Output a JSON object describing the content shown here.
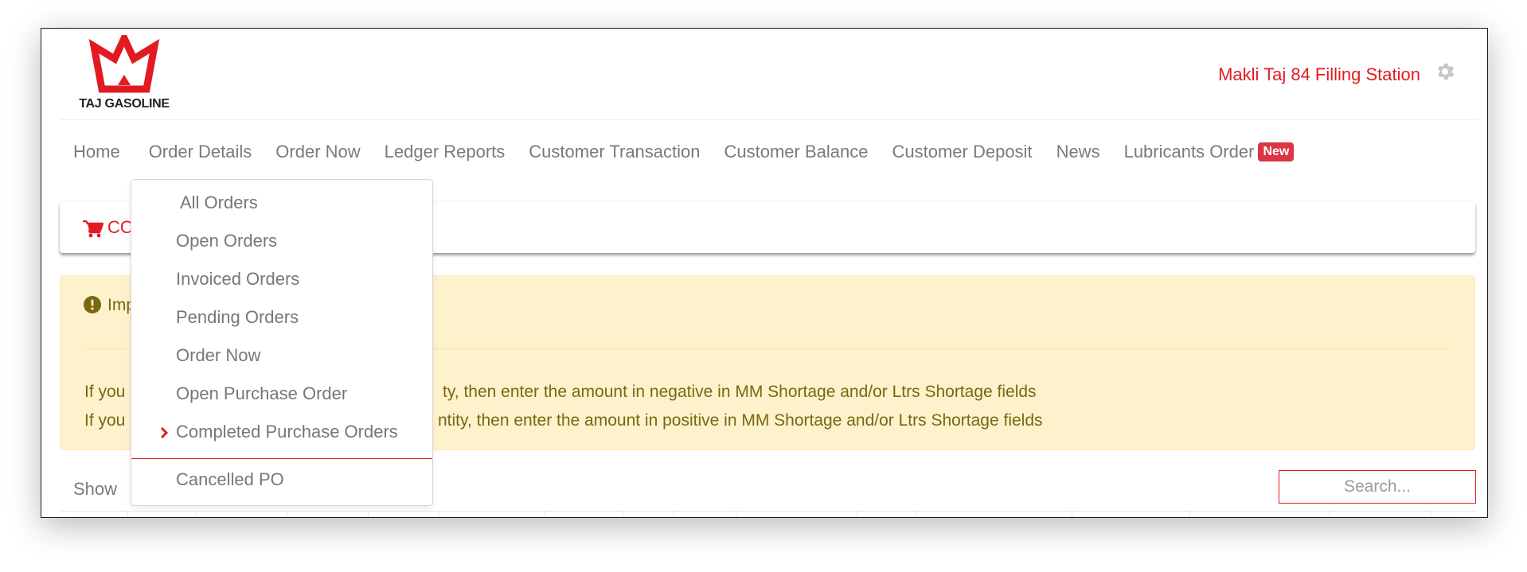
{
  "brand": {
    "logo_text": "TAJ GASOLINE"
  },
  "header": {
    "station_name": "Makli Taj 84 Filling Station",
    "settings_icon": "gear-icon"
  },
  "nav": {
    "items": [
      {
        "label": "Home"
      },
      {
        "label": "Order Details"
      },
      {
        "label": "Order Now"
      },
      {
        "label": "Ledger Reports"
      },
      {
        "label": "Customer Transaction"
      },
      {
        "label": "Customer Balance"
      },
      {
        "label": "Customer Deposit"
      },
      {
        "label": "News"
      },
      {
        "label": "Lubricants Order",
        "badge": "New"
      }
    ]
  },
  "dropdown": {
    "items": [
      {
        "label": "All Orders"
      },
      {
        "label": "Open Orders"
      },
      {
        "label": "Invoiced Orders"
      },
      {
        "label": "Pending Orders"
      },
      {
        "label": "Order Now"
      },
      {
        "label": "Open Purchase Order"
      },
      {
        "label": "Completed Purchase Orders",
        "active": true
      },
      {
        "label": "Cancelled PO"
      }
    ]
  },
  "cart": {
    "text_visible": "CO",
    "icon": "cart-icon"
  },
  "alert": {
    "title_visible": "Imp",
    "line1_left": "If you",
    "line1_right": "ty, then enter the amount in negative in MM Shortage and/or Ltrs Shortage fields",
    "line2_left": "If you",
    "line2_right": "ntity, then enter the amount in positive in MM Shortage and/or Ltrs Shortage fields",
    "icon": "exclamation-circle-icon"
  },
  "table_controls": {
    "show_label": "Show",
    "search_placeholder": "Search..."
  },
  "colors": {
    "brand_red": "#e21b23",
    "alert_bg": "#fdf2cb",
    "alert_text": "#7b6614",
    "badge_red": "#dc3545"
  }
}
